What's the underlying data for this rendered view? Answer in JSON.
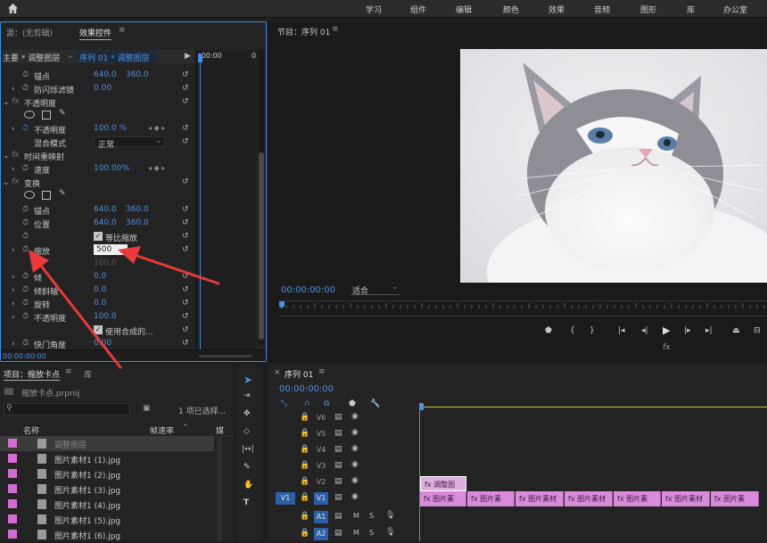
{
  "top_menu": [
    "学习",
    "组件",
    "编辑",
    "颜色",
    "效果",
    "音频",
    "图形",
    "库",
    "办公室"
  ],
  "effect_controls": {
    "tab_source": "源：(无剪辑)",
    "tab_effect": "效果控件",
    "menu_glyph": "≡",
    "clip_main": "主要 * 调整图层",
    "clip_seq": "序列 01 * 调整图层",
    "time_start": ":00:00",
    "time_end": "0",
    "rows": [
      {
        "name": "锚点",
        "v1": "640.0",
        "v2": "360.0"
      },
      {
        "name": "防闪烁滤镜",
        "v1": "0.00",
        "v2": ""
      },
      {
        "name": "不透明度",
        "v1": "",
        "v2": ""
      },
      {
        "name": "不透明度",
        "v1": "100.0 %",
        "v2": ""
      },
      {
        "name": "混合模式",
        "v1": "正常",
        "v2": ""
      },
      {
        "name": "时间重映射",
        "v1": "",
        "v2": ""
      },
      {
        "name": "速度",
        "v1": "100.00%",
        "v2": ""
      },
      {
        "name": "变换",
        "v1": "",
        "v2": ""
      },
      {
        "name": "锚点",
        "v1": "640.0",
        "v2": "360.0"
      },
      {
        "name": "位置",
        "v1": "640.0",
        "v2": "360.0"
      },
      {
        "name": "等比缩放",
        "v1": "",
        "v2": ""
      },
      {
        "name": "缩放",
        "v1": "500",
        "v2": ""
      },
      {
        "name": "",
        "v1": "100.0",
        "v2": ""
      },
      {
        "name": "倾",
        "v1": "0.0",
        "v2": ""
      },
      {
        "name": "倾斜轴",
        "v1": "0.0",
        "v2": ""
      },
      {
        "name": "旋转",
        "v1": "0.0",
        "v2": ""
      },
      {
        "name": "不透明度",
        "v1": "100.0",
        "v2": ""
      },
      {
        "name": "使用合成的...",
        "v1": "",
        "v2": ""
      },
      {
        "name": "快门角度",
        "v1": "0.00",
        "v2": ""
      }
    ],
    "footer_time": "00:00:00:00"
  },
  "program_monitor": {
    "title": "节目：序列 01",
    "menu_glyph": "≡",
    "timecode": "00:00:00:00",
    "zoom": "适合",
    "fx_label": "fx"
  },
  "project": {
    "tab": "项目：缩放卡点",
    "tab_lib": "库",
    "menu_glyph": "≡",
    "file": "缩放卡点.prproj",
    "search_placeholder": "",
    "selected": "1 项已选择...",
    "col_name": "名称",
    "col_rate": "帧速率",
    "col_media": "媒",
    "items": [
      "调整图层",
      "图片素材1 (1).jpg",
      "图片素材1 (2).jpg",
      "图片素材1 (3).jpg",
      "图片素材1 (4).jpg",
      "图片素材1 (5).jpg",
      "图片素材1 (6).jpg"
    ]
  },
  "timeline": {
    "title": "序列 01",
    "menu_glyph": "≡",
    "close": "×",
    "timecode": "00:00:00:00",
    "tracks": [
      "V6",
      "V5",
      "V4",
      "V3",
      "V2",
      "V1",
      "A1",
      "A2"
    ],
    "src_v1": "V1",
    "src_a1": "A1",
    "src_a2": "A2",
    "adj_clip": "调整图",
    "clips": [
      "图片素",
      "图片素",
      "图片素材",
      "图片素材",
      "图片素",
      "图片素材",
      "图片素",
      "图片素"
    ],
    "m_label": "M",
    "s_label": "S"
  },
  "colors": {
    "accent": "#3a8ee6",
    "clip": "#d78bd8",
    "label": "#d36dd4",
    "value": "#4f8fe0"
  }
}
